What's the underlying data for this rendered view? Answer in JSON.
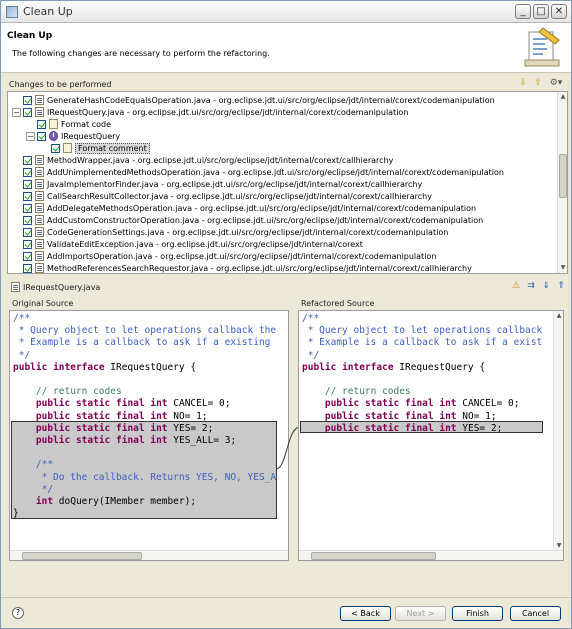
{
  "window": {
    "title": "Clean Up",
    "buttons": {
      "minimize": "_",
      "maximize": "□",
      "close": "✕"
    }
  },
  "banner": {
    "heading": "Clean Up",
    "description": "The following changes are necessary to perform the refactoring."
  },
  "changes": {
    "label": "Changes to be performed",
    "rows": [
      {
        "indent": 0,
        "type": "java",
        "text": "GenerateHashCodeEqualsOperation.java - org.eclipse.jdt.ui/src/org/eclipse/jdt/internal/corext/codemanipulation",
        "toggle": ""
      },
      {
        "indent": 0,
        "type": "java",
        "text": "IRequestQuery.java - org.eclipse.jdt.ui/src/org/eclipse/jdt/internal/corext/codemanipulation",
        "toggle": "−"
      },
      {
        "indent": 1,
        "type": "doc",
        "text": "Format code",
        "toggle": ""
      },
      {
        "indent": 1,
        "type": "iface",
        "text": "IRequestQuery",
        "toggle": "−"
      },
      {
        "indent": 2,
        "type": "doc",
        "text": "Format comment",
        "toggle": "",
        "selected": true
      },
      {
        "indent": 0,
        "type": "java",
        "text": "MethodWrapper.java - org.eclipse.jdt.ui/src/org/eclipse/jdt/internal/corext/callhierarchy",
        "toggle": ""
      },
      {
        "indent": 0,
        "type": "java",
        "text": "AddUnimplementedMethodsOperation.java - org.eclipse.jdt.ui/src/org/eclipse/jdt/internal/corext/codemanipulation",
        "toggle": ""
      },
      {
        "indent": 0,
        "type": "java",
        "text": "JavaImplementorFinder.java - org.eclipse.jdt.ui/src/org/eclipse/jdt/internal/corext/callhierarchy",
        "toggle": ""
      },
      {
        "indent": 0,
        "type": "java",
        "text": "CallSearchResultCollector.java - org.eclipse.jdt.ui/src/org/eclipse/jdt/internal/corext/callhierarchy",
        "toggle": ""
      },
      {
        "indent": 0,
        "type": "java",
        "text": "AddDelegateMethodsOperation.java - org.eclipse.jdt.ui/src/org/eclipse/jdt/internal/corext/codemanipulation",
        "toggle": ""
      },
      {
        "indent": 0,
        "type": "java",
        "text": "AddCustomConstructorOperation.java - org.eclipse.jdt.ui/src/org/eclipse/jdt/internal/corext/codemanipulation",
        "toggle": ""
      },
      {
        "indent": 0,
        "type": "java",
        "text": "CodeGenerationSettings.java - org.eclipse.jdt.ui/src/org/eclipse/jdt/internal/corext/codemanipulation",
        "toggle": ""
      },
      {
        "indent": 0,
        "type": "java",
        "text": "ValidateEditException.java - org.eclipse.jdt.ui/src/org/eclipse/jdt/internal/corext",
        "toggle": ""
      },
      {
        "indent": 0,
        "type": "java",
        "text": "AddImportsOperation.java - org.eclipse.jdt.ui/src/org/eclipse/jdt/internal/corext/codemanipulation",
        "toggle": ""
      },
      {
        "indent": 0,
        "type": "java",
        "text": "MethodReferencesSearchRequestor.java - org.eclipse.jdt.ui/src/org/eclipse/jdt/internal/corext/callhierarchy",
        "toggle": ""
      }
    ]
  },
  "compare": {
    "file": "IRequestQuery.java",
    "left_title": "Original Source",
    "right_title": "Refactored Source",
    "left_lines": [
      {
        "cls": "cm",
        "t": "/**"
      },
      {
        "cls": "cm",
        "t": " * Query object to let operations callback the"
      },
      {
        "cls": "cm",
        "t": " * Example is a callback to ask if a existing"
      },
      {
        "cls": "cm",
        "t": " */"
      },
      {
        "cls": "mix",
        "t": "public interface IRequestQuery {"
      },
      {
        "cls": "",
        "t": ""
      },
      {
        "cls": "cm2",
        "t": "    // return codes"
      },
      {
        "cls": "mix",
        "t": "    public static final int CANCEL= 0;"
      },
      {
        "cls": "mix",
        "t": "    public static final int NO= 1;"
      },
      {
        "cls": "mix",
        "t": "    public static final int YES= 2;"
      },
      {
        "cls": "mix",
        "t": "    public static final int YES_ALL= 3;"
      },
      {
        "cls": "",
        "t": ""
      },
      {
        "cls": "cm",
        "t": "    /**"
      },
      {
        "cls": "cm",
        "t": "     * Do the callback. Returns YES, NO, YES_A"
      },
      {
        "cls": "cm",
        "t": "     */"
      },
      {
        "cls": "",
        "t": "    int doQuery(IMember member);"
      },
      {
        "cls": "",
        "t": "}"
      }
    ],
    "right_lines": [
      {
        "cls": "cm",
        "t": "/**"
      },
      {
        "cls": "cm",
        "t": " * Query object to let operations callback"
      },
      {
        "cls": "cm",
        "t": " * Example is a callback to ask if a exist"
      },
      {
        "cls": "cm",
        "t": " */"
      },
      {
        "cls": "mix",
        "t": "public interface IRequestQuery {"
      },
      {
        "cls": "",
        "t": ""
      },
      {
        "cls": "cm2",
        "t": "    // return codes"
      },
      {
        "cls": "mix",
        "t": "    public static final int CANCEL= 0;"
      },
      {
        "cls": "mix",
        "t": "    public static final int NO= 1;"
      },
      {
        "cls": "mix",
        "t": "    public static final int YES= 2;"
      }
    ]
  },
  "footer": {
    "help": "?",
    "back": "< Back",
    "next": "Next >",
    "finish": "Finish",
    "cancel": "Cancel"
  }
}
